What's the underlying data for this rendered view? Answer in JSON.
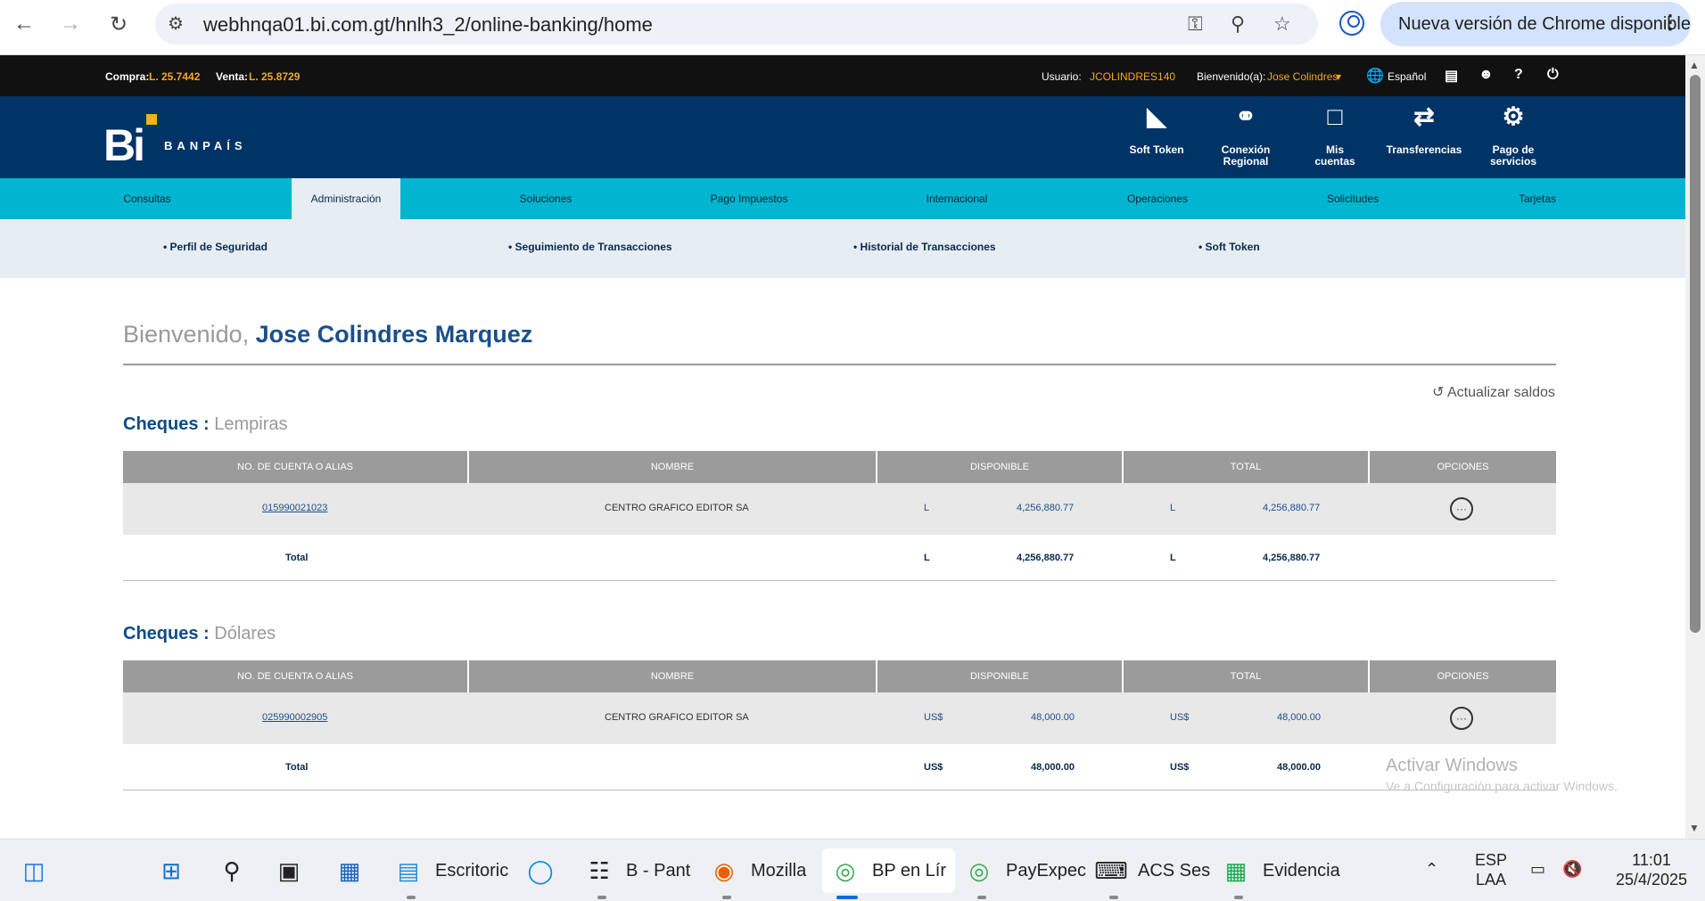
{
  "browser": {
    "url": "webhnqa01.bi.com.gt/hnlh3_2/online-banking/home",
    "update_label": "Nueva versión de Chrome disponible"
  },
  "topbar": {
    "compra_label": "Compra:",
    "compra_value": "L. 25.7442",
    "venta_label": "Venta:",
    "venta_value": "L. 25.8729",
    "usuario_label": "Usuario:",
    "usuario_value": "JCOLINDRES140",
    "bienvenido_label": "Bienvenido(a):",
    "bienvenido_value": "Jose Colindres",
    "language": "Español"
  },
  "header": {
    "logo_text": "Bi",
    "logo_subtext": "BANPAÍS",
    "quick_links": [
      {
        "label": "Soft Token",
        "icon": "soft-token-icon"
      },
      {
        "label": "Conexión Regional",
        "icon": "connection-icon"
      },
      {
        "label": "Mis cuentas",
        "icon": "wallet-icon"
      },
      {
        "label": "Transferencias",
        "icon": "transfer-icon"
      },
      {
        "label": "Pago de servicios",
        "icon": "service-payment-icon"
      }
    ]
  },
  "nav": {
    "tabs": [
      "Consultas",
      "Administración",
      "Soluciones",
      "Pago Impuestos",
      "Internacional",
      "Operaciones",
      "Solicitudes",
      "Tarjetas"
    ],
    "active_tab": "Administración"
  },
  "subnav": {
    "items": [
      "Perfil de Seguridad",
      "Seguimiento de Transacciones",
      "Historial de Transacciones",
      "Soft Token"
    ]
  },
  "welcome": {
    "greeting": "Bienvenido,",
    "name": "Jose Colindres Marquez"
  },
  "refresh_label": "Actualizar saldos",
  "columns": [
    "NO. DE CUENTA O ALIAS",
    "NOMBRE",
    "DISPONIBLE",
    "TOTAL",
    "OPCIONES"
  ],
  "sections": [
    {
      "title": "Cheques :",
      "currency_name": "Lempiras",
      "rows": [
        {
          "account": "015990021023",
          "name": "CENTRO GRAFICO EDITOR SA",
          "disp_cur": "L",
          "disp_amt": "4,256,880.77",
          "tot_cur": "L",
          "tot_amt": "4,256,880.77"
        }
      ],
      "total": {
        "label": "Total",
        "disp_cur": "L",
        "disp_amt": "4,256,880.77",
        "tot_cur": "L",
        "tot_amt": "4,256,880.77"
      }
    },
    {
      "title": "Cheques :",
      "currency_name": "Dólares",
      "rows": [
        {
          "account": "025990002905",
          "name": "CENTRO GRAFICO EDITOR SA",
          "disp_cur": "US$",
          "disp_amt": "48,000.00",
          "tot_cur": "US$",
          "tot_amt": "48,000.00"
        }
      ],
      "total": {
        "label": "Total",
        "disp_cur": "US$",
        "disp_amt": "48,000.00",
        "tot_cur": "US$",
        "tot_amt": "48,000.00"
      }
    }
  ],
  "watermark": {
    "line1": "Activar Windows",
    "line2": "Ve a Configuración para activar Windows."
  },
  "taskbar": {
    "apps": [
      {
        "label": "Escritoric",
        "icon": "file-explorer-icon"
      },
      {
        "label": "",
        "icon": "edge-icon"
      },
      {
        "label": "B - Pant",
        "icon": "network-icon"
      },
      {
        "label": "Mozilla",
        "icon": "firefox-icon"
      },
      {
        "label": "BP en Lír",
        "icon": "chrome-icon"
      },
      {
        "label": "PayExpec",
        "icon": "chrome-icon"
      },
      {
        "label": "ACS Ses",
        "icon": "terminal-icon"
      },
      {
        "label": "Evidencia",
        "icon": "spreadsheet-icon"
      }
    ],
    "lang_top": "ESP",
    "lang_bottom": "LAA",
    "time": "11:01",
    "date": "25/4/2025"
  }
}
